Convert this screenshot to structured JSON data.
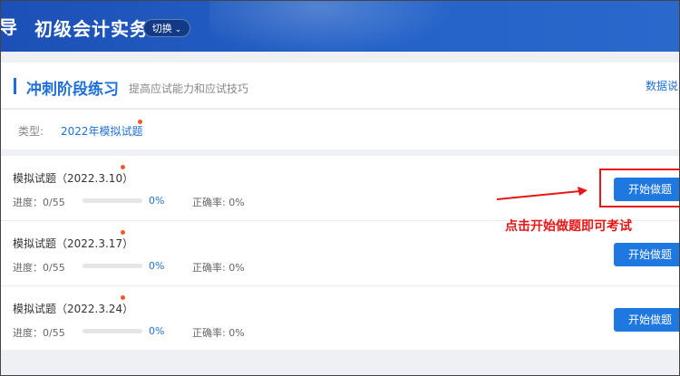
{
  "header": {
    "cut_text": "导",
    "title": "初级会计实务",
    "switch_label": "切换"
  },
  "section": {
    "title": "冲刺阶段练习",
    "subtitle": "提高应试能力和应试技巧",
    "data_link": "数据说明"
  },
  "filter": {
    "type_label": "类型:",
    "type_value": "2022年模拟试题"
  },
  "exams": [
    {
      "title": "模拟试题（2022.3.10）",
      "progress_text": "进度：0/55",
      "progress_value": 0,
      "percent": "0%",
      "accuracy": "正确率: 0%",
      "button": "开始做题"
    },
    {
      "title": "模拟试题（2022.3.17）",
      "progress_text": "进度：0/55",
      "progress_value": 0,
      "percent": "0%",
      "accuracy": "正确率: 0%",
      "button": "开始做题"
    },
    {
      "title": "模拟试题（2022.3.24）",
      "progress_text": "进度：0/55",
      "progress_value": 0,
      "percent": "0%",
      "accuracy": "正确率: 0%",
      "button": "开始做题"
    }
  ],
  "annotation": {
    "text": "点击开始做题即可考试"
  },
  "colors": {
    "header_blue": "#1c50b6",
    "accent": "#1e6fd9",
    "button": "#1f78e0",
    "new_dot": "#f05a2a",
    "annotation_red": "#e81616"
  }
}
